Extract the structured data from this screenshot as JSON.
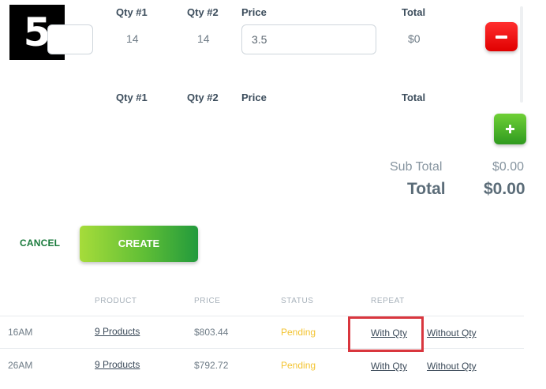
{
  "step_number": "5",
  "line_items": {
    "row1": {
      "headers": {
        "qty1": "Qty #1",
        "qty2": "Qty #2",
        "price": "Price",
        "total": "Total"
      },
      "qty1": "14",
      "qty2": "14",
      "price": "3.5",
      "total": "$0"
    },
    "row2": {
      "headers": {
        "qty1": "Qty #1",
        "qty2": "Qty #2",
        "price": "Price",
        "total": "Total"
      }
    }
  },
  "summary": {
    "subtotal_label": "Sub Total",
    "subtotal_value": "$0.00",
    "total_label": "Total",
    "total_value": "$0.00"
  },
  "actions": {
    "cancel_label": "CANCEL",
    "create_label": "CREATE"
  },
  "orders_table": {
    "columns": [
      "PRODUCT",
      "PRICE",
      "STATUS",
      "REPEAT"
    ],
    "rows": [
      {
        "time": "16AM",
        "product": "9 Products",
        "price": "$803.44",
        "status": "Pending",
        "repeat_with": "With Qty",
        "repeat_without": "Without Qty"
      },
      {
        "time": "26AM",
        "product": "9 Products",
        "price": "$792.72",
        "status": "Pending",
        "repeat_with": "With Qty",
        "repeat_without": "Without Qty"
      }
    ]
  },
  "colors": {
    "remove_button": "#e00000",
    "add_button": "#3aa52a",
    "create_button": "#5fbe36",
    "pending_status": "#f3c330",
    "highlight": "#d9363e"
  },
  "icons": {
    "remove": "minus-icon",
    "add": "plus-icon"
  }
}
